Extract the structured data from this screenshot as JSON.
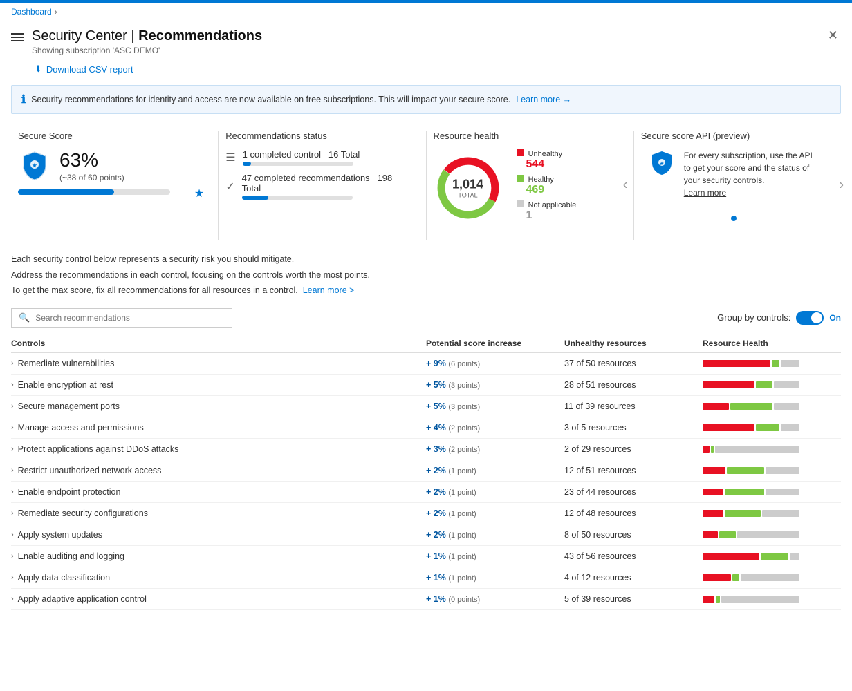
{
  "topBar": {},
  "breadcrumb": {
    "dashboard": "Dashboard",
    "separator": "›"
  },
  "header": {
    "title_prefix": "Security Center",
    "title_separator": " | ",
    "title_suffix": "Recommendations",
    "subtitle": "Showing subscription 'ASC DEMO'",
    "close_label": "✕"
  },
  "toolbar": {
    "download_label": "Download CSV report"
  },
  "banner": {
    "text": "Security recommendations for identity and access are now available on free subscriptions. This will impact your secure score.",
    "link_text": "Learn more →"
  },
  "stats": {
    "secureScore": {
      "title": "Secure Score",
      "percentage": "63%",
      "subtitle": "(~38 of 60 points)",
      "bar_width": "63"
    },
    "recommendationsStatus": {
      "title": "Recommendations status",
      "completed_controls": "1",
      "completed_controls_label": "completed control",
      "total_controls": "16 Total",
      "completed_recs": "47",
      "completed_recs_label": "completed",
      "completed_recs_sub": "recommendations",
      "total_recs": "198 Total"
    },
    "resourceHealth": {
      "title": "Resource health",
      "total": "1,014",
      "total_label": "TOTAL",
      "unhealthy_label": "Unhealthy",
      "unhealthy_count": "544",
      "healthy_label": "Healthy",
      "healthy_count": "469",
      "na_label": "Not applicable",
      "na_count": "1"
    },
    "apiPreview": {
      "title": "Secure score API (preview)",
      "description": "For every subscription, use the API to get your score and the status of your security controls.",
      "link_text": "Learn more"
    }
  },
  "contextText": {
    "line1": "Each security control below represents a security risk you should mitigate.",
    "line2": "Address the recommendations in each control, focusing on the controls worth the most points.",
    "line3": "To get the max score, fix all recommendations for all resources in a control.",
    "link": "Learn more >"
  },
  "search": {
    "placeholder": "Search recommendations"
  },
  "groupBy": {
    "label": "Group by controls:",
    "state": "On"
  },
  "table": {
    "headers": {
      "controls": "Controls",
      "potentialScore": "Potential score increase",
      "unhealthyResources": "Unhealthy resources",
      "resourceHealth": "Resource Health"
    },
    "rows": [
      {
        "name": "Remediate vulnerabilities",
        "score": "+ 9%",
        "points": "(6 points)",
        "unhealthy": "37 of 50 resources",
        "redPct": 72,
        "greenPct": 8,
        "grayPct": 20
      },
      {
        "name": "Enable encryption at rest",
        "score": "+ 5%",
        "points": "(3 points)",
        "unhealthy": "28 of 51 resources",
        "redPct": 55,
        "greenPct": 18,
        "grayPct": 27
      },
      {
        "name": "Secure management ports",
        "score": "+ 5%",
        "points": "(3 points)",
        "unhealthy": "11 of 39 resources",
        "redPct": 28,
        "greenPct": 45,
        "grayPct": 27
      },
      {
        "name": "Manage access and permissions",
        "score": "+ 4%",
        "points": "(2 points)",
        "unhealthy": "3 of 5 resources",
        "redPct": 55,
        "greenPct": 25,
        "grayPct": 20
      },
      {
        "name": "Protect applications against DDoS attacks",
        "score": "+ 3%",
        "points": "(2 points)",
        "unhealthy": "2 of 29 resources",
        "redPct": 7,
        "greenPct": 3,
        "grayPct": 90
      },
      {
        "name": "Restrict unauthorized network access",
        "score": "+ 2%",
        "points": "(1 point)",
        "unhealthy": "12 of 51 resources",
        "redPct": 24,
        "greenPct": 40,
        "grayPct": 36
      },
      {
        "name": "Enable endpoint protection",
        "score": "+ 2%",
        "points": "(1 point)",
        "unhealthy": "23 of 44 resources",
        "redPct": 22,
        "greenPct": 42,
        "grayPct": 36
      },
      {
        "name": "Remediate security configurations",
        "score": "+ 2%",
        "points": "(1 point)",
        "unhealthy": "12 of 48 resources",
        "redPct": 22,
        "greenPct": 38,
        "grayPct": 40
      },
      {
        "name": "Apply system updates",
        "score": "+ 2%",
        "points": "(1 point)",
        "unhealthy": "8 of 50 resources",
        "redPct": 16,
        "greenPct": 18,
        "grayPct": 66
      },
      {
        "name": "Enable auditing and logging",
        "score": "+ 1%",
        "points": "(1 point)",
        "unhealthy": "43 of 56 resources",
        "redPct": 60,
        "greenPct": 30,
        "grayPct": 10
      },
      {
        "name": "Apply data classification",
        "score": "+ 1%",
        "points": "(1 point)",
        "unhealthy": "4 of 12 resources",
        "redPct": 30,
        "greenPct": 8,
        "grayPct": 62
      },
      {
        "name": "Apply adaptive application control",
        "score": "+ 1%",
        "points": "(0 points)",
        "unhealthy": "5 of 39 resources",
        "redPct": 12,
        "greenPct": 5,
        "grayPct": 83
      }
    ]
  }
}
